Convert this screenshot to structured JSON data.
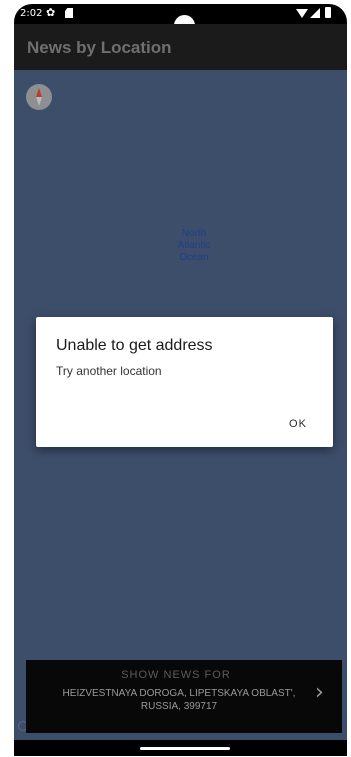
{
  "status_bar": {
    "time": "2:02",
    "icons": [
      "settings-gear-icon",
      "sd-card-icon",
      "wifi-icon",
      "cell-signal-icon",
      "battery-icon"
    ]
  },
  "app_bar": {
    "title": "News by Location"
  },
  "map": {
    "ocean_label_lines": [
      "North",
      "Atlantic",
      "Ocean"
    ],
    "background_color": "#3d4e6b",
    "compass_icon": "compass-icon"
  },
  "news_bar": {
    "heading": "SHOW NEWS FOR",
    "address_lines": [
      "HEIZVESTNAYA DOROGA, LIPETSKAYA OBLAST',",
      "RUSSIA, 399717"
    ],
    "chevron_icon": "chevron-right-icon"
  },
  "dialog": {
    "title": "Unable to get address",
    "message": "Try another location",
    "ok_label": "OK"
  }
}
